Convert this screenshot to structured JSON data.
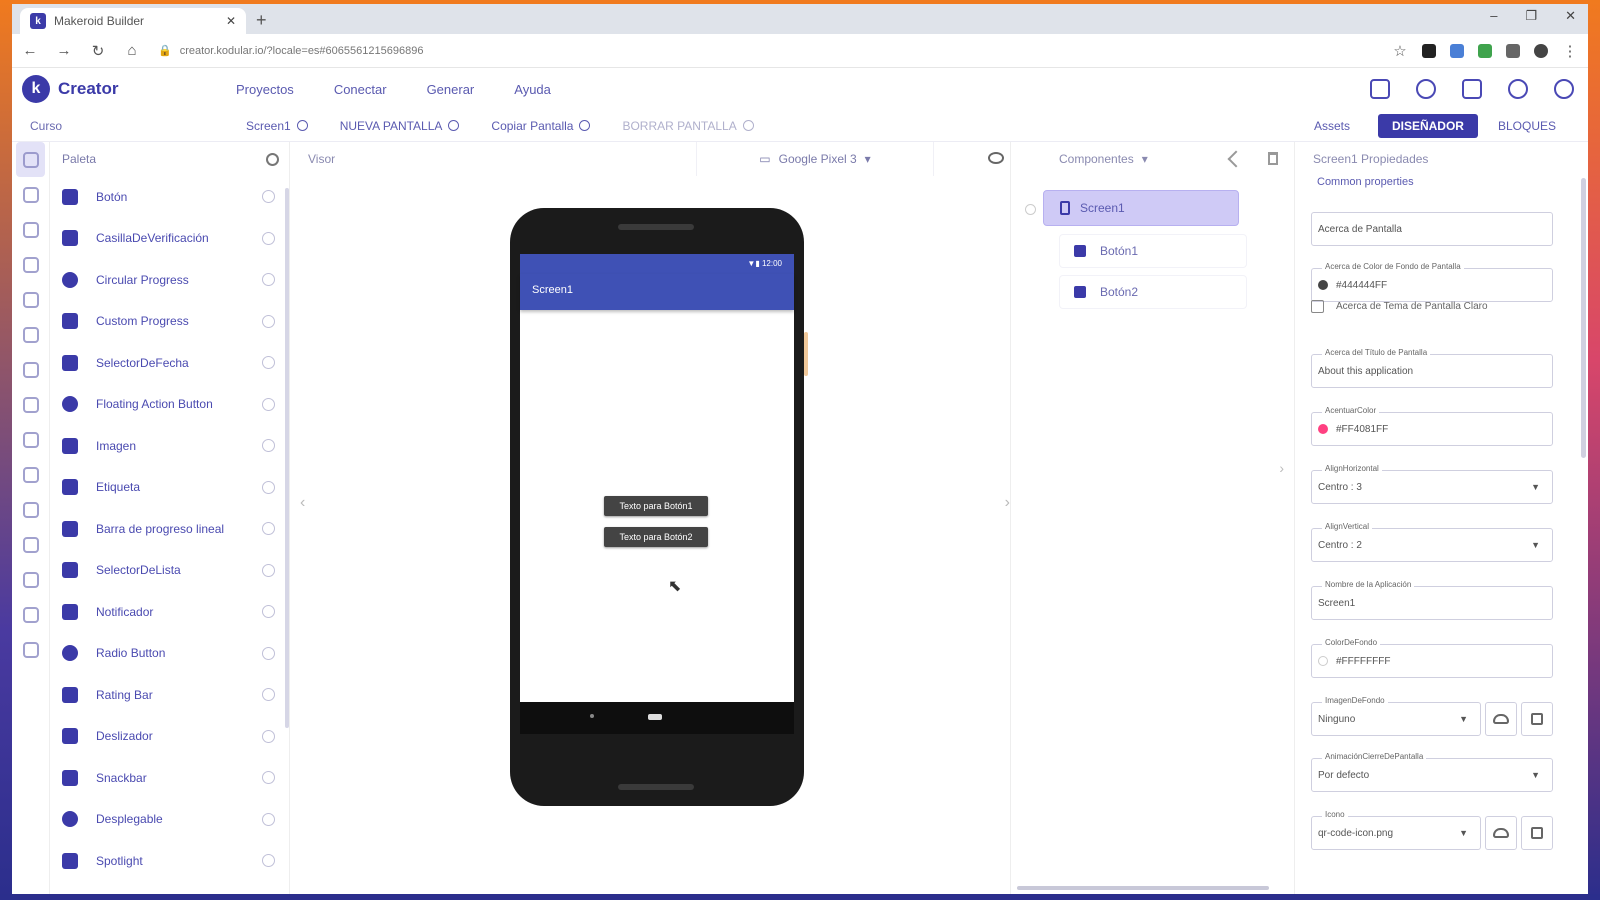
{
  "browser": {
    "tab_title": "Makeroid Builder",
    "tab_favicon": "k",
    "tab_close": "✕",
    "new_tab": "+",
    "url": "creator.kodular.io/?locale=es#6065561215696896",
    "window_controls": [
      "–",
      "❐",
      "✕"
    ]
  },
  "app": {
    "brand": "Creator",
    "logo_letter": "k",
    "menu": [
      "Proyectos",
      "Conectar",
      "Generar",
      "Ayuda"
    ]
  },
  "toolbar": {
    "project_name": "Curso",
    "screen_selector": "Screen1",
    "new_screen": "NUEVA PANTALLA",
    "copy_screen": "Copiar Pantalla",
    "delete_screen": "BORRAR PANTALLA",
    "assets": "Assets",
    "designer": "DISEÑADOR",
    "blocks": "BLOQUES"
  },
  "palette": {
    "title": "Paleta",
    "items": [
      {
        "label": "Botón",
        "icon": "button-icon"
      },
      {
        "label": "CasillaDeVerificación",
        "icon": "checkbox-icon"
      },
      {
        "label": "Circular Progress",
        "icon": "circular-progress-icon"
      },
      {
        "label": "Custom Progress",
        "icon": "custom-progress-icon"
      },
      {
        "label": "SelectorDeFecha",
        "icon": "date-picker-icon"
      },
      {
        "label": "Floating Action Button",
        "icon": "fab-icon"
      },
      {
        "label": "Imagen",
        "icon": "image-icon"
      },
      {
        "label": "Etiqueta",
        "icon": "label-icon"
      },
      {
        "label": "Barra de progreso lineal",
        "icon": "linear-progress-icon"
      },
      {
        "label": "SelectorDeLista",
        "icon": "list-picker-icon"
      },
      {
        "label": "Notificador",
        "icon": "notifier-icon"
      },
      {
        "label": "Radio Button",
        "icon": "radio-button-icon"
      },
      {
        "label": "Rating Bar",
        "icon": "rating-bar-icon"
      },
      {
        "label": "Deslizador",
        "icon": "slider-icon"
      },
      {
        "label": "Snackbar",
        "icon": "snackbar-icon"
      },
      {
        "label": "Desplegable",
        "icon": "spinner-icon"
      },
      {
        "label": "Spotlight",
        "icon": "spotlight-icon"
      }
    ]
  },
  "viewer": {
    "title": "Visor",
    "device": "Google Pixel 3",
    "status_time": "12:00",
    "screen_title": "Screen1",
    "buttons": [
      "Texto para Botón1",
      "Texto para Botón2"
    ]
  },
  "components": {
    "title": "Componentes",
    "root": "Screen1",
    "children": [
      "Botón1",
      "Botón2"
    ]
  },
  "properties": {
    "title": "Screen1 Propiedades",
    "section": "Common properties",
    "about_screen": "Acerca de Pantalla",
    "about_bg_color_label": "Acerca de Color de Fondo de Pantalla",
    "about_bg_color_value": "#444444FF",
    "about_light_theme": "Acerca de Tema de Pantalla Claro",
    "about_title_label": "Acerca del Título de Pantalla",
    "about_title_value": "About this application",
    "accent_color_label": "AcentuarColor",
    "accent_color_value": "#FF4081FF",
    "align_h_label": "AlignHorizontal",
    "align_h_value": "Centro : 3",
    "align_v_label": "AlignVertical",
    "align_v_value": "Centro : 2",
    "app_name_label": "Nombre de la Aplicación",
    "app_name_value": "Screen1",
    "bg_color_label": "ColorDeFondo",
    "bg_color_value": "#FFFFFFFF",
    "bg_image_label": "ImagenDeFondo",
    "bg_image_value": "Ninguno",
    "close_anim_label": "AnimaciónCierreDePantalla",
    "close_anim_value": "Por defecto",
    "icon_label": "Icono",
    "icon_value": "qr-code-icon.png"
  },
  "colors": {
    "accent": "#3b3aa8",
    "appbar": "#3f51b5",
    "swatch_dark": "#444444",
    "swatch_pink": "#ff4081"
  }
}
